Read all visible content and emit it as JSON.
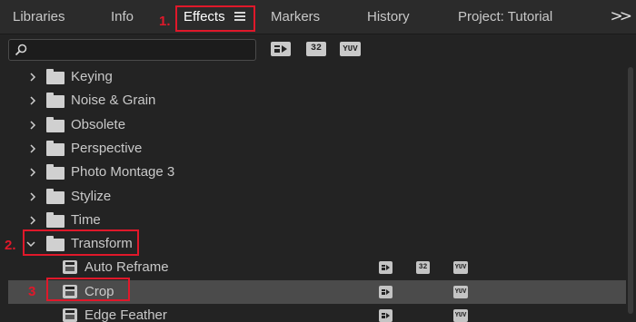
{
  "tabs": [
    {
      "label": "Libraries",
      "active": false
    },
    {
      "label": "Info",
      "active": false
    },
    {
      "label": "Effects",
      "active": true
    },
    {
      "label": "Markers",
      "active": false
    },
    {
      "label": "History",
      "active": false
    },
    {
      "label": "Project: Tutorial",
      "active": false
    }
  ],
  "overflow_label": ">>",
  "search": {
    "value": "",
    "placeholder": ""
  },
  "filter_buttons": [
    {
      "label": "",
      "icon": "accelerated-effects-icon"
    },
    {
      "label": "32",
      "icon": "32-bit-icon"
    },
    {
      "label": "YUV",
      "icon": "yuv-icon"
    }
  ],
  "tree": [
    {
      "label": "Keying",
      "type": "folder",
      "expanded": false
    },
    {
      "label": "Noise & Grain",
      "type": "folder",
      "expanded": false
    },
    {
      "label": "Obsolete",
      "type": "folder",
      "expanded": false
    },
    {
      "label": "Perspective",
      "type": "folder",
      "expanded": false
    },
    {
      "label": "Photo Montage 3",
      "type": "folder",
      "expanded": false
    },
    {
      "label": "Stylize",
      "type": "folder",
      "expanded": false
    },
    {
      "label": "Time",
      "type": "folder",
      "expanded": false
    },
    {
      "label": "Transform",
      "type": "folder",
      "expanded": true
    },
    {
      "label": "Auto Reframe",
      "type": "effect",
      "badges": {
        "accel": true,
        "b32": "32",
        "yuv": "YUV"
      }
    },
    {
      "label": "Crop",
      "type": "effect",
      "selected": true,
      "badges": {
        "accel": true,
        "b32": "",
        "yuv": "YUV"
      }
    },
    {
      "label": "Edge Feather",
      "type": "effect",
      "badges": {
        "accel": true,
        "b32": "",
        "yuv": "YUV"
      }
    }
  ],
  "annotations": [
    {
      "label": "1."
    },
    {
      "label": "2."
    },
    {
      "label": "3"
    }
  ],
  "colors": {
    "annotation": "#e0182a",
    "background": "#232323",
    "selected_row": "#4b4b4b"
  }
}
